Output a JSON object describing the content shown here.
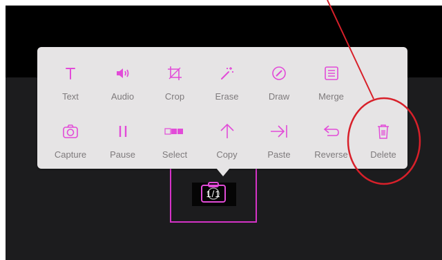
{
  "colors": {
    "accent": "#e24bd8",
    "menu_background": "#e6e4e5",
    "label": "#7e7a7c",
    "stage_background": "#1c1c1e",
    "top_band": "#000000",
    "clip_border": "#d633c8",
    "annotation": "#d8202a"
  },
  "menu": {
    "row1": [
      {
        "label": "Text",
        "icon": "text-icon"
      },
      {
        "label": "Audio",
        "icon": "speaker-icon"
      },
      {
        "label": "Crop",
        "icon": "crop-icon"
      },
      {
        "label": "Erase",
        "icon": "magic-wand-icon"
      },
      {
        "label": "Draw",
        "icon": "pencil-circle-icon"
      },
      {
        "label": "Merge",
        "icon": "merge-list-icon"
      }
    ],
    "row2": [
      {
        "label": "Capture",
        "icon": "camera-icon"
      },
      {
        "label": "Pause",
        "icon": "pause-icon"
      },
      {
        "label": "Select",
        "icon": "select-blocks-icon"
      },
      {
        "label": "Copy",
        "icon": "arrow-up-icon"
      },
      {
        "label": "Paste",
        "icon": "arrow-right-bar-icon"
      },
      {
        "label": "Reverse",
        "icon": "return-arrow-icon"
      },
      {
        "label": "Delete",
        "icon": "trash-icon"
      }
    ]
  },
  "clip": {
    "counter": "1/1"
  }
}
